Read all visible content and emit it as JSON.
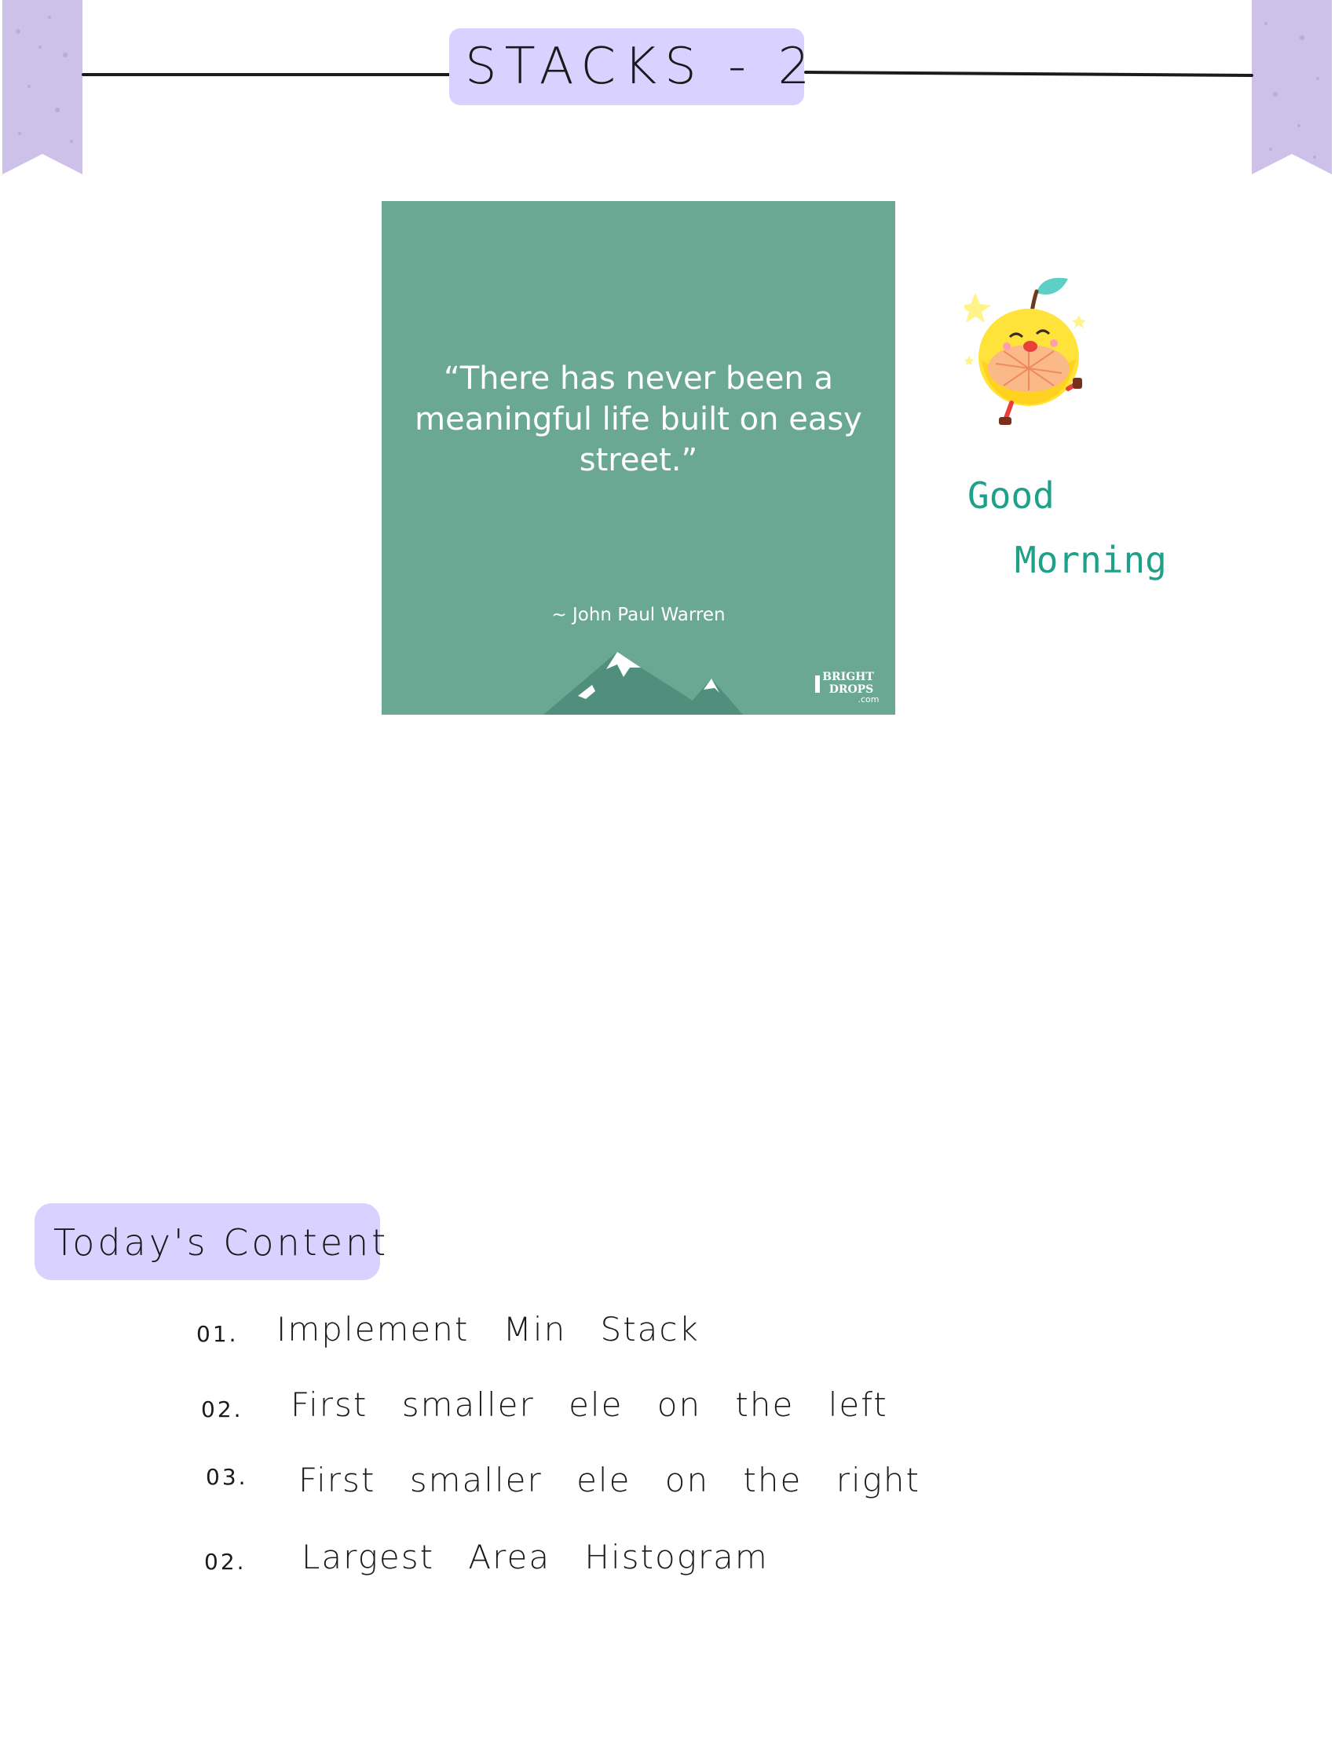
{
  "header": {
    "title": "STACKS - 2"
  },
  "quote_card": {
    "quote": "“There has never been a meaningful life built on easy street.”",
    "author": "~ John Paul Warren",
    "brand": {
      "line1": "BRIGHT",
      "line2": "DROPS",
      "line3": ".com"
    }
  },
  "greeting": {
    "line1": "Good",
    "line2": "Morning"
  },
  "todays_content": {
    "heading": "Today's Content",
    "items": [
      {
        "number": "01.",
        "text": "Implement Min Stack"
      },
      {
        "number": "02.",
        "text": "First smaller ele on the left"
      },
      {
        "number": "03.",
        "text": "First smaller ele on the right"
      },
      {
        "number": "02.",
        "text": "Largest Area Histogram"
      }
    ]
  },
  "colors": {
    "highlight": "#d9d1ff",
    "ribbon": "#cdc1e9",
    "quote_card_bg": "#6aa894",
    "greeting_ink": "#1fa088",
    "ink": "#1a1a1a"
  },
  "icons": {
    "sticker": "lemon-character-icon",
    "mountains": "mountain-range-icon",
    "ribbons": "bookmark-ribbon-icon"
  }
}
